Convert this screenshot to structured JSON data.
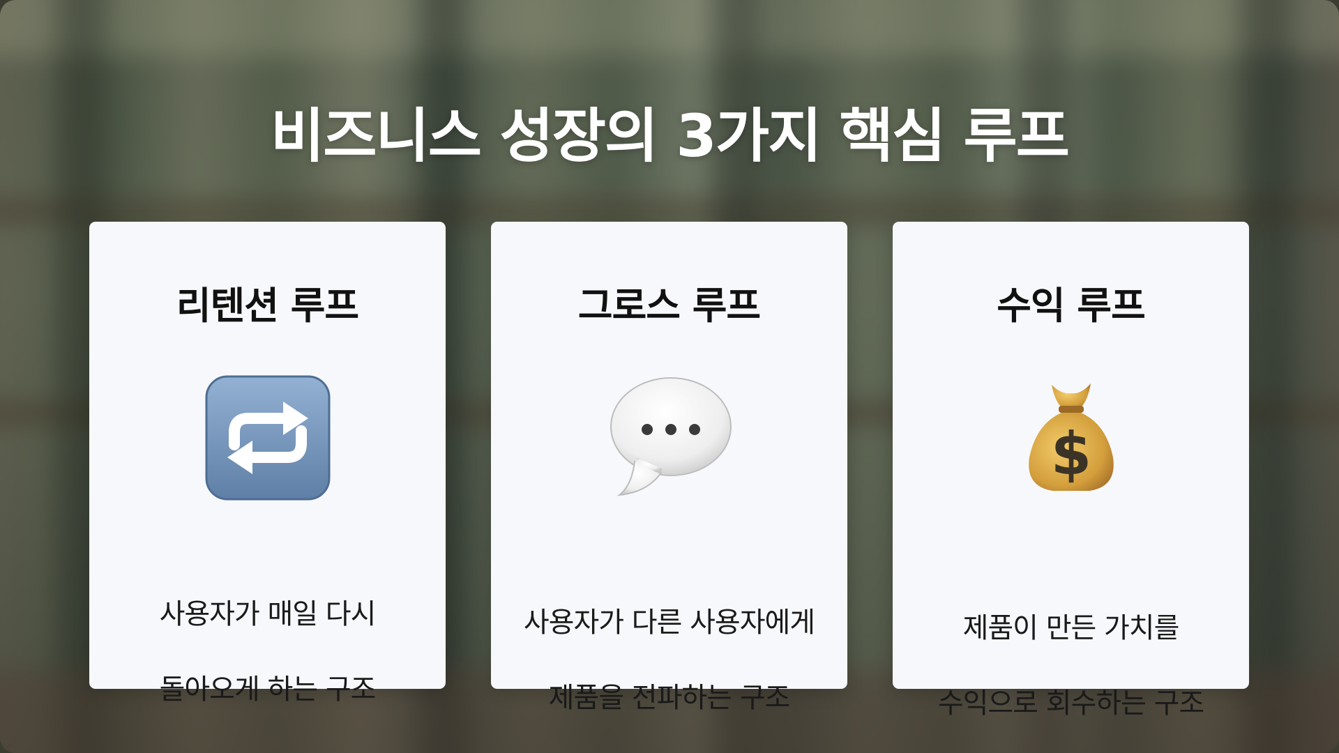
{
  "title": "비즈니스 성장의 3가지 핵심 루프",
  "cards": [
    {
      "title": "리텐션 루프",
      "icon": "repeat-icon",
      "desc_line1": "사용자가 매일 다시",
      "desc_line2": "돌아오게 하는 구조"
    },
    {
      "title": "그로스 루프",
      "icon": "speech-bubble-icon",
      "desc_line1": "사용자가 다른 사용자에게",
      "desc_line2": "제품을 전파하는 구조"
    },
    {
      "title": "수익 루프",
      "icon": "money-bag-icon",
      "desc_line1": "제품이 만든 가치를",
      "desc_line2": "수익으로 회수하는 구조"
    }
  ],
  "colors": {
    "card_background": "#f7f8fb",
    "title_text": "#ffffff",
    "repeat_icon": "#7e9dc0",
    "money_bag": "#c9953a"
  }
}
